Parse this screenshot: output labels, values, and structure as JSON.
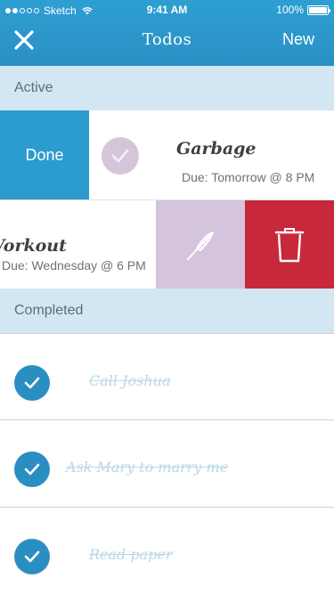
{
  "status_bar": {
    "carrier": "Sketch",
    "time": "9:41 AM",
    "battery": "100%"
  },
  "nav": {
    "title": "Todos",
    "new_label": "New",
    "close_icon": "close-icon"
  },
  "sections": {
    "active": "Active",
    "completed": "Completed"
  },
  "active": [
    {
      "title": "Garbage",
      "due": "Due: Tomorrow @ 8 PM",
      "swipe_action": "Done"
    },
    {
      "title": "Workout",
      "due": "Due: Wednesday @ 6 PM"
    }
  ],
  "completed": [
    {
      "title": "Call Joshua"
    },
    {
      "title": "Ask Mary to marry me"
    },
    {
      "title": "Read paper"
    }
  ],
  "colors": {
    "header": "#2a8fc4",
    "done": "#2c9bcf",
    "edit": "#d4c4dc",
    "delete": "#c8283b",
    "section_bg": "#d2e7f1"
  }
}
